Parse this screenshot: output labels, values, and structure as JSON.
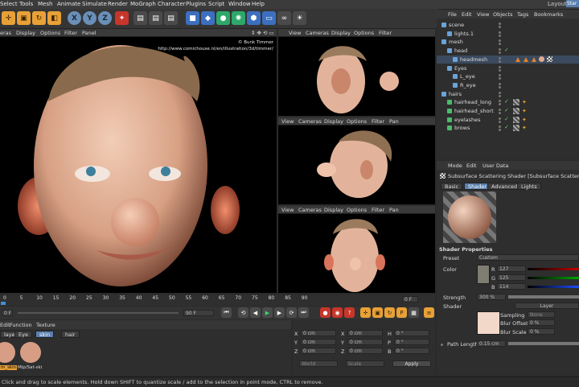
{
  "menubar": {
    "items": [
      "Select",
      "Tools",
      "Mesh",
      "Animate",
      "Simulate",
      "Render",
      "MoGraph",
      "Character",
      "Plugins",
      "Script",
      "Window",
      "Help"
    ],
    "layout_label": "Layout:",
    "layout_value": "Star"
  },
  "toolbar": {
    "axis_x": "X",
    "axis_y": "Y",
    "axis_z": "Z"
  },
  "viewport_main": {
    "menu": [
      "eras",
      "Display",
      "Options",
      "Filter",
      "Panel"
    ],
    "credit_line1": "© Bunk Timmer",
    "credit_line2": "http://www.comichouse.nl/en/illustration/3d/timmer/"
  },
  "viewport_small": {
    "menu_top": [
      "View",
      "Cameras",
      "Display",
      "Options",
      "Filter"
    ],
    "menu": [
      "View",
      "Cameras",
      "Display",
      "Options",
      "Filter",
      "Pan"
    ]
  },
  "object_manager": {
    "menu": [
      "File",
      "Edit",
      "View",
      "Objects",
      "Tags",
      "Bookmarks"
    ],
    "tree": [
      {
        "label": "scene",
        "indent": 0,
        "type": "null"
      },
      {
        "label": "lights.1",
        "indent": 1,
        "type": "null"
      },
      {
        "label": "mesh",
        "indent": 0,
        "type": "null"
      },
      {
        "label": "head",
        "indent": 1,
        "type": "poly"
      },
      {
        "label": "headmesh",
        "indent": 2,
        "type": "poly"
      },
      {
        "label": "Eyes",
        "indent": 1,
        "type": "null"
      },
      {
        "label": "L_eye",
        "indent": 2,
        "type": "null"
      },
      {
        "label": "R_eye",
        "indent": 2,
        "type": "null"
      },
      {
        "label": "hairs",
        "indent": 0,
        "type": "null"
      },
      {
        "label": "hairhead_long",
        "indent": 1,
        "type": "hair"
      },
      {
        "label": "hairhead_short",
        "indent": 1,
        "type": "hair"
      },
      {
        "label": "eyelashes",
        "indent": 1,
        "type": "hair"
      },
      {
        "label": "brows",
        "indent": 1,
        "type": "hair"
      }
    ]
  },
  "attributes": {
    "menu": [
      "Mode",
      "Edit",
      "User Data"
    ],
    "shader_title": "Subsurface Scattering Shader [Subsurface Scattering]",
    "tabs": [
      "Basic",
      "Shader",
      "Advanced",
      "Lights"
    ],
    "active_tab": "Shader",
    "section_title": "Shader Properties",
    "preset_label": "Preset",
    "preset_value": "Custom",
    "color_label": "Color",
    "r_label": "R",
    "r_value": "127",
    "g_label": "G",
    "g_value": "125",
    "b_label": "B",
    "b_value": "114",
    "strength_label": "Strength",
    "strength_value": "300 %",
    "shader_label": "Shader",
    "layer_button": "Layer",
    "sampling_label": "Sampling",
    "sampling_value": "None",
    "blur_offset_label": "Blur Offset",
    "blur_offset_value": "0 %",
    "blur_scale_label": "Blur Scale",
    "blur_scale_value": "0 %",
    "path_length_label": "Path Length",
    "path_length_value": "0.15 cm"
  },
  "timeline": {
    "ticks": [
      "0",
      "5",
      "10",
      "15",
      "20",
      "25",
      "30",
      "35",
      "40",
      "45",
      "50",
      "55",
      "60",
      "65",
      "70",
      "75",
      "80",
      "85",
      "90"
    ],
    "frame_current": "0 F",
    "frame_end": "90 F",
    "frame_right": "0 F"
  },
  "material_manager": {
    "menu": [
      "Edit",
      "Function",
      "Texture"
    ],
    "tabs": [
      "layer",
      "Eye",
      "skin",
      "hair"
    ],
    "active_tab": "skin",
    "materials": [
      "m_skin",
      "Mip/Sat-ski"
    ]
  },
  "coordinates": {
    "rows": [
      {
        "axis": "X",
        "pos": "0 cm",
        "axis2": "X",
        "size": "0 cm",
        "axis3": "H",
        "rot": "0 °"
      },
      {
        "axis": "Y",
        "pos": "0 cm",
        "axis2": "Y",
        "size": "0 cm",
        "axis3": "P",
        "rot": "0 °"
      },
      {
        "axis": "Z",
        "pos": "0 cm",
        "axis2": "Z",
        "size": "0 cm",
        "axis3": "B",
        "rot": "0 °"
      }
    ],
    "mode_world": "World",
    "mode_scale": "Scale",
    "apply_button": "Apply"
  },
  "status": {
    "text": "Click and drag to scale elements. Hold down SHIFT to quantize scale / add to the selection in point mode, CTRL to remove."
  },
  "colors": {
    "accent_blue": "#5b7fae",
    "orange": "#e8a137",
    "skin": "#e0a98f"
  }
}
